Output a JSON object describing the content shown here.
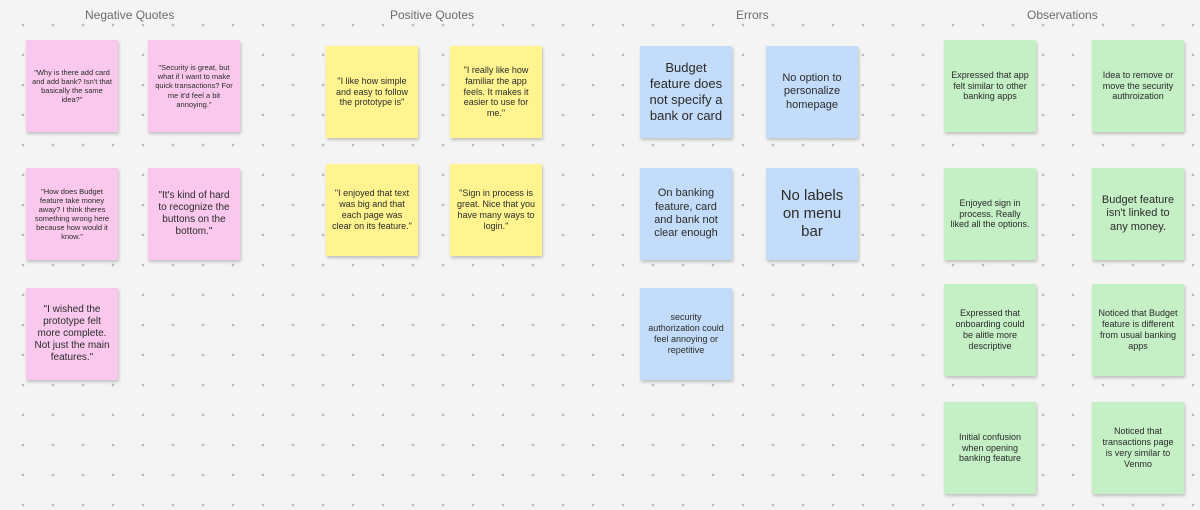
{
  "board": {
    "columns": [
      {
        "title": "Negative Quotes"
      },
      {
        "title": "Positive Quotes"
      },
      {
        "title": "Errors"
      },
      {
        "title": "Observations"
      }
    ]
  },
  "notes": {
    "negative": [
      {
        "text": "\"Why is there add card and add bank? Isn't that basically the same idea?\"",
        "color": "#f9c8ec"
      },
      {
        "text": "\"Security is great, but what if I want to make quick transactions? For me it'd feel a bit annoying.\"",
        "color": "#f9c8ec"
      },
      {
        "text": "\"How does Budget feature take money away? I think theres something wrong here because how would it know.\"",
        "color": "#f9c8ec"
      },
      {
        "text": "\"It's kind of hard to recognize the buttons on the bottom.\"",
        "color": "#f9c8ec"
      },
      {
        "text": "\"I wished the prototype felt more complete. Not just the main features.\"",
        "color": "#f9c8ec"
      }
    ],
    "positive": [
      {
        "text": "\"I like how simple and easy to follow the prototype is\"",
        "color": "#fff48f"
      },
      {
        "text": "\"I really like how familiar the app feels. It makes it easier to use for me.\"",
        "color": "#fff48f"
      },
      {
        "text": "\"I enjoyed that text was big and that each page was clear on its feature.\"",
        "color": "#fff48f"
      },
      {
        "text": "\"Sign in process is great. Nice that you have many ways to login.\"",
        "color": "#fff48f"
      }
    ],
    "errors": [
      {
        "text": "Budget feature does not specify a bank or card",
        "color": "#c3dcf9"
      },
      {
        "text": "No option to personalize homepage",
        "color": "#c3dcf9"
      },
      {
        "text": "On banking feature, card and bank not clear enough",
        "color": "#c3dcf9"
      },
      {
        "text": "No labels on menu bar",
        "color": "#c3dcf9"
      },
      {
        "text": "security authorization could feel annoying or repetitive",
        "color": "#c3dcf9"
      }
    ],
    "observations": [
      {
        "text": "Expressed that app felt similar to other banking apps",
        "color": "#c5efc4"
      },
      {
        "text": "Idea to remove or move the security authroization",
        "color": "#c5efc4"
      },
      {
        "text": "Enjoyed sign in process. Really liked all the options.",
        "color": "#c5efc4"
      },
      {
        "text": "Budget feature isn't linked to any money.",
        "color": "#c5efc4"
      },
      {
        "text": "Expressed that onboarding could be alitle more descriptive",
        "color": "#c5efc4"
      },
      {
        "text": "Noticed that Budget feature is different from usual banking apps",
        "color": "#c5efc4"
      },
      {
        "text": "Initial confusion when opening banking feature",
        "color": "#c5efc4"
      },
      {
        "text": "Noticed that transactions page is very similar to Venmo",
        "color": "#c5efc4"
      }
    ]
  }
}
